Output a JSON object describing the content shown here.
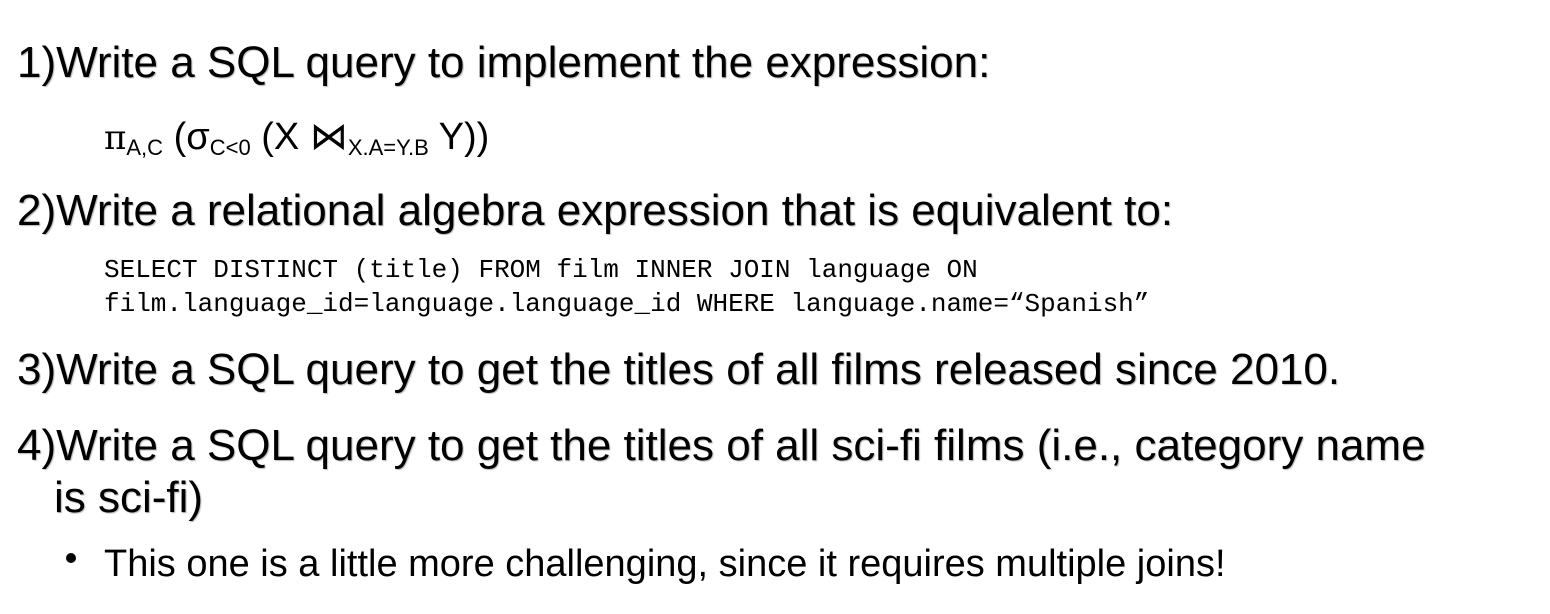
{
  "questions": [
    {
      "number": "1)",
      "text": "Write a SQL query to implement the expression:"
    },
    {
      "number": "2)",
      "text": "Write a relational algebra expression that is equivalent to:"
    },
    {
      "number": "3)",
      "text": "Write a SQL query to get the titles of all films released since 2010."
    },
    {
      "number": "4)",
      "text": "Write a SQL query to get the titles of all sci-fi films (i.e., category name",
      "continuation": "is sci-fi)"
    }
  ],
  "expression": {
    "pi": "π",
    "pi_sub": "A,C",
    "open1": " (",
    "sigma": "σ",
    "sigma_sub": "C<0",
    "open2": " (X ",
    "join": "⋈",
    "join_sub": "X.A=Y.B",
    "close": " Y))"
  },
  "sql": {
    "line1": "SELECT DISTINCT (title) FROM film INNER JOIN language ON",
    "line2": "film.language_id=language.language_id WHERE language.name=“Spanish”"
  },
  "bullet": "This one is a little more challenging, since it requires multiple joins!"
}
